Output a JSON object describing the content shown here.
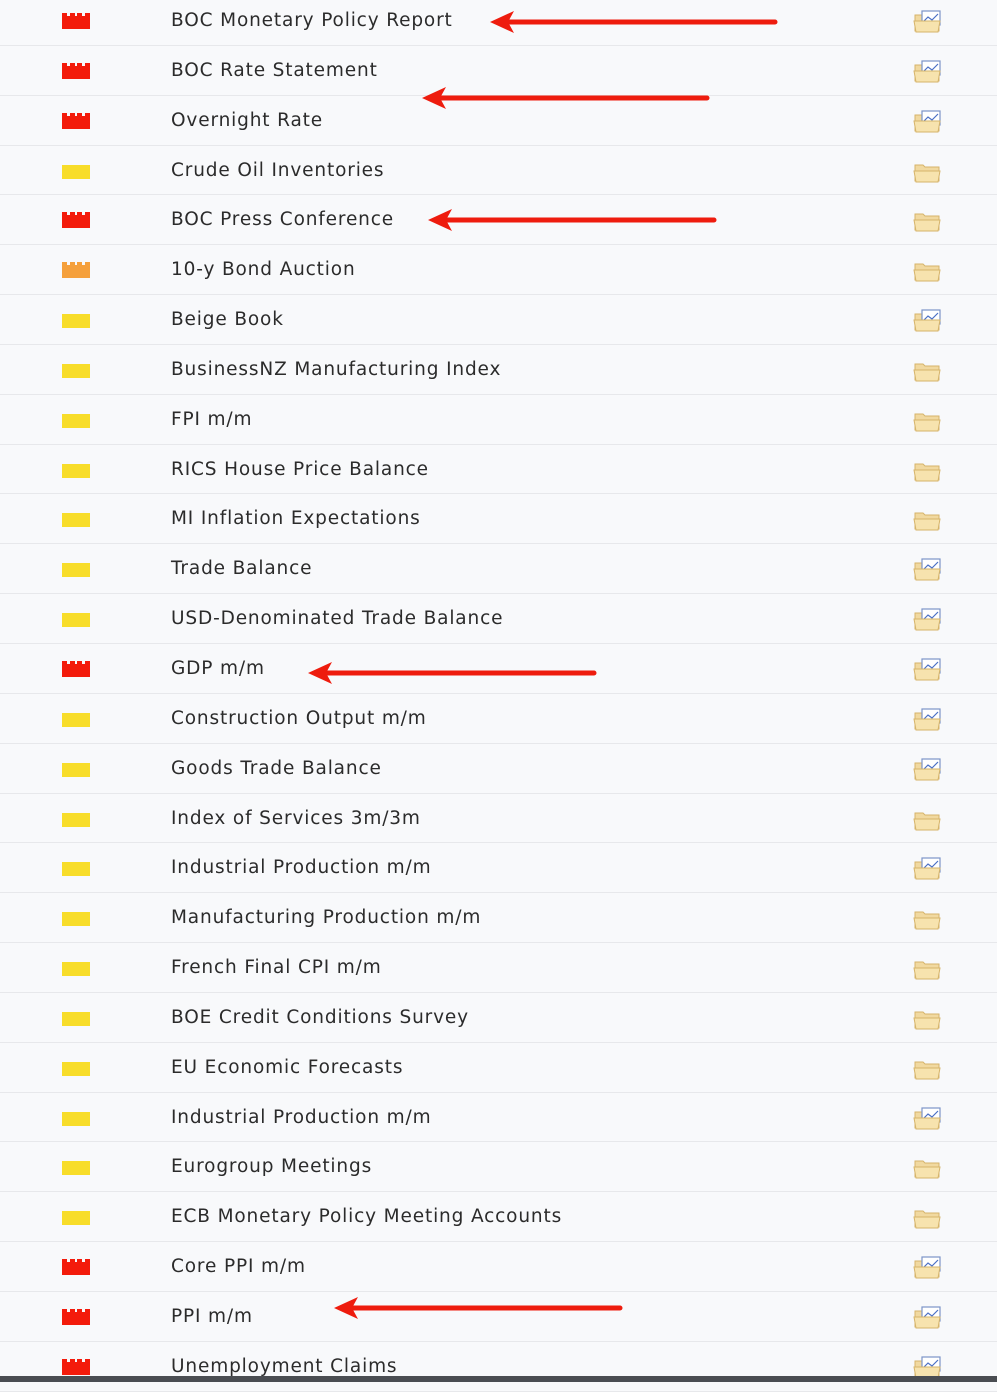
{
  "events": [
    {
      "name": "BOC Monetary Policy Report",
      "impact": "high",
      "detail": "graph"
    },
    {
      "name": "BOC Rate Statement",
      "impact": "high",
      "detail": "graph"
    },
    {
      "name": "Overnight Rate",
      "impact": "high",
      "detail": "graph"
    },
    {
      "name": "Crude Oil Inventories",
      "impact": "low",
      "detail": "plain"
    },
    {
      "name": "BOC Press Conference",
      "impact": "high",
      "detail": "plain"
    },
    {
      "name": "10-y Bond Auction",
      "impact": "medium",
      "detail": "plain"
    },
    {
      "name": "Beige Book",
      "impact": "low",
      "detail": "graph"
    },
    {
      "name": "BusinessNZ Manufacturing Index",
      "impact": "low",
      "detail": "plain"
    },
    {
      "name": "FPI m/m",
      "impact": "low",
      "detail": "plain"
    },
    {
      "name": "RICS House Price Balance",
      "impact": "low",
      "detail": "plain"
    },
    {
      "name": "MI Inflation Expectations",
      "impact": "low",
      "detail": "plain"
    },
    {
      "name": "Trade Balance",
      "impact": "low",
      "detail": "graph"
    },
    {
      "name": "USD-Denominated Trade Balance",
      "impact": "low",
      "detail": "graph"
    },
    {
      "name": "GDP m/m",
      "impact": "high",
      "detail": "graph"
    },
    {
      "name": "Construction Output m/m",
      "impact": "low",
      "detail": "graph"
    },
    {
      "name": "Goods Trade Balance",
      "impact": "low",
      "detail": "graph"
    },
    {
      "name": "Index of Services 3m/3m",
      "impact": "low",
      "detail": "plain"
    },
    {
      "name": "Industrial Production m/m",
      "impact": "low",
      "detail": "graph"
    },
    {
      "name": "Manufacturing Production m/m",
      "impact": "low",
      "detail": "plain"
    },
    {
      "name": "French Final CPI m/m",
      "impact": "low",
      "detail": "plain"
    },
    {
      "name": "BOE Credit Conditions Survey",
      "impact": "low",
      "detail": "plain"
    },
    {
      "name": "EU Economic Forecasts",
      "impact": "low",
      "detail": "plain"
    },
    {
      "name": "Industrial Production m/m",
      "impact": "low",
      "detail": "graph"
    },
    {
      "name": "Eurogroup Meetings",
      "impact": "low",
      "detail": "plain"
    },
    {
      "name": "ECB Monetary Policy Meeting Accounts",
      "impact": "low",
      "detail": "plain"
    },
    {
      "name": "Core PPI m/m",
      "impact": "high",
      "detail": "graph"
    },
    {
      "name": "PPI m/m",
      "impact": "high",
      "detail": "graph"
    },
    {
      "name": "Unemployment Claims",
      "impact": "high",
      "detail": "graph"
    }
  ],
  "colors": {
    "impact_high": "#f31b0b",
    "impact_medium": "#f5a03c",
    "impact_low": "#f8dd2a",
    "annotation_arrow": "#ee1c0e",
    "text": "#2b2b2b"
  },
  "icons": {
    "impact": "impact-flag-icon",
    "detail": "folder-icon",
    "annotation": "red-arrow-annotation"
  }
}
